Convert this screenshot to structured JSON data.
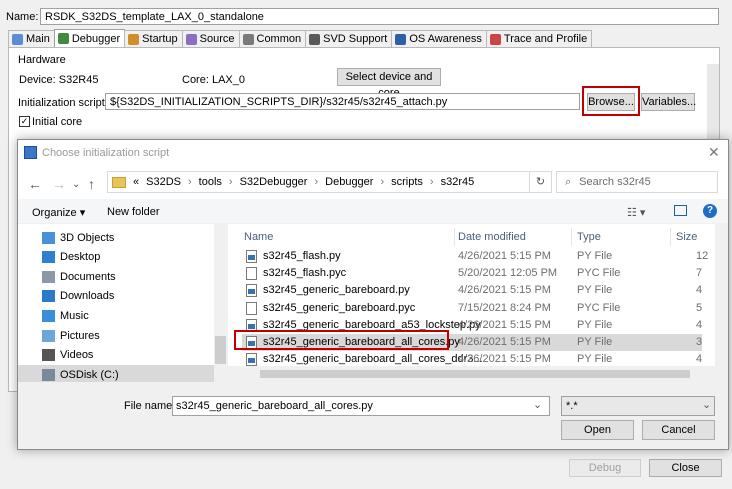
{
  "launch": {
    "name_label": "Name:",
    "name_value": "RSDK_S32DS_template_LAX_0_standalone",
    "tabs": [
      {
        "label": "Main",
        "icon": "main-tab-icon",
        "color": "#5b8dd6"
      },
      {
        "label": "Debugger",
        "icon": "debugger-tab-icon",
        "color": "#3f8a3f"
      },
      {
        "label": "Startup",
        "icon": "startup-tab-icon",
        "color": "#d08f2a"
      },
      {
        "label": "Source",
        "icon": "source-tab-icon",
        "color": "#8a6fc1"
      },
      {
        "label": "Common",
        "icon": "common-tab-icon",
        "color": "#7a7a7a"
      },
      {
        "label": "SVD Support",
        "icon": "svd-tab-icon",
        "color": "#5a5a5a"
      },
      {
        "label": "OS Awareness",
        "icon": "os-tab-icon",
        "color": "#2d5fa6"
      },
      {
        "label": "Trace and Profile",
        "icon": "trace-tab-icon",
        "color": "#c44"
      }
    ],
    "hardware_label": "Hardware",
    "device_label": "Device: S32R45",
    "core_label": "Core: LAX_0",
    "select_device_button": "Select device and core",
    "init_script_label": "Initialization script:",
    "init_script_value": "${S32DS_INITIALIZATION_SCRIPTS_DIR}/s32r45/s32r45_attach.py",
    "browse_button": "Browse...",
    "variables_button": "Variables...",
    "initial_core_label": "Initial core",
    "initial_core_checked": "✓",
    "debug_button": "Debug",
    "close_button": "Close"
  },
  "dialog": {
    "title": "Choose initialization script",
    "breadcrumb": [
      "«",
      "S32DS",
      "tools",
      "S32Debugger",
      "Debugger",
      "scripts",
      "s32r45"
    ],
    "search_placeholder": "Search s32r45",
    "organize_label": "Organize ▾",
    "new_folder_label": "New folder",
    "nav_items": [
      {
        "label": "3D Objects",
        "icon": "3d-objects-icon",
        "color": "#4a90d9"
      },
      {
        "label": "Desktop",
        "icon": "desktop-icon",
        "color": "#2f7fd0"
      },
      {
        "label": "Documents",
        "icon": "documents-icon",
        "color": "#8a99a8"
      },
      {
        "label": "Downloads",
        "icon": "downloads-icon",
        "color": "#2b79c9"
      },
      {
        "label": "Music",
        "icon": "music-icon",
        "color": "#3a8fdc"
      },
      {
        "label": "Pictures",
        "icon": "pictures-icon",
        "color": "#6aa6d8"
      },
      {
        "label": "Videos",
        "icon": "videos-icon",
        "color": "#555"
      },
      {
        "label": "OSDisk (C:)",
        "icon": "drive-icon",
        "color": "#7a8a99"
      }
    ],
    "columns": {
      "name": "Name",
      "date": "Date modified",
      "type": "Type",
      "size": "Size"
    },
    "files": [
      {
        "name": "s32r45_flash.py",
        "date": "4/26/2021 5:15 PM",
        "type": "PY File",
        "size": "12",
        "kind": "py"
      },
      {
        "name": "s32r45_flash.pyc",
        "date": "5/20/2021 12:05 PM",
        "type": "PYC File",
        "size": "7",
        "kind": "pyc"
      },
      {
        "name": "s32r45_generic_bareboard.py",
        "date": "4/26/2021 5:15 PM",
        "type": "PY File",
        "size": "4",
        "kind": "py"
      },
      {
        "name": "s32r45_generic_bareboard.pyc",
        "date": "7/15/2021 8:24 PM",
        "type": "PYC File",
        "size": "5",
        "kind": "pyc"
      },
      {
        "name": "s32r45_generic_bareboard_a53_lockstep.py",
        "date": "4/26/2021 5:15 PM",
        "type": "PY File",
        "size": "4",
        "kind": "py"
      },
      {
        "name": "s32r45_generic_bareboard_all_cores.py",
        "date": "4/26/2021 5:15 PM",
        "type": "PY File",
        "size": "3",
        "kind": "py"
      },
      {
        "name": "s32r45_generic_bareboard_all_cores_ddr3...",
        "date": "4/26/2021 5:15 PM",
        "type": "PY File",
        "size": "4",
        "kind": "py"
      },
      {
        "name": "s32r45_generic_bareboard_all_cores_lpdd...",
        "date": "4/26/2021 5:15 PM",
        "type": "PY File",
        "size": "4",
        "kind": "py"
      }
    ],
    "selected_file_index": 5,
    "file_name_label": "File name:",
    "file_name_value": "s32r45_generic_bareboard_all_cores.py",
    "filter_value": "*.*",
    "open_button": "Open",
    "cancel_button": "Cancel",
    "highlight_color": "#c00000"
  }
}
